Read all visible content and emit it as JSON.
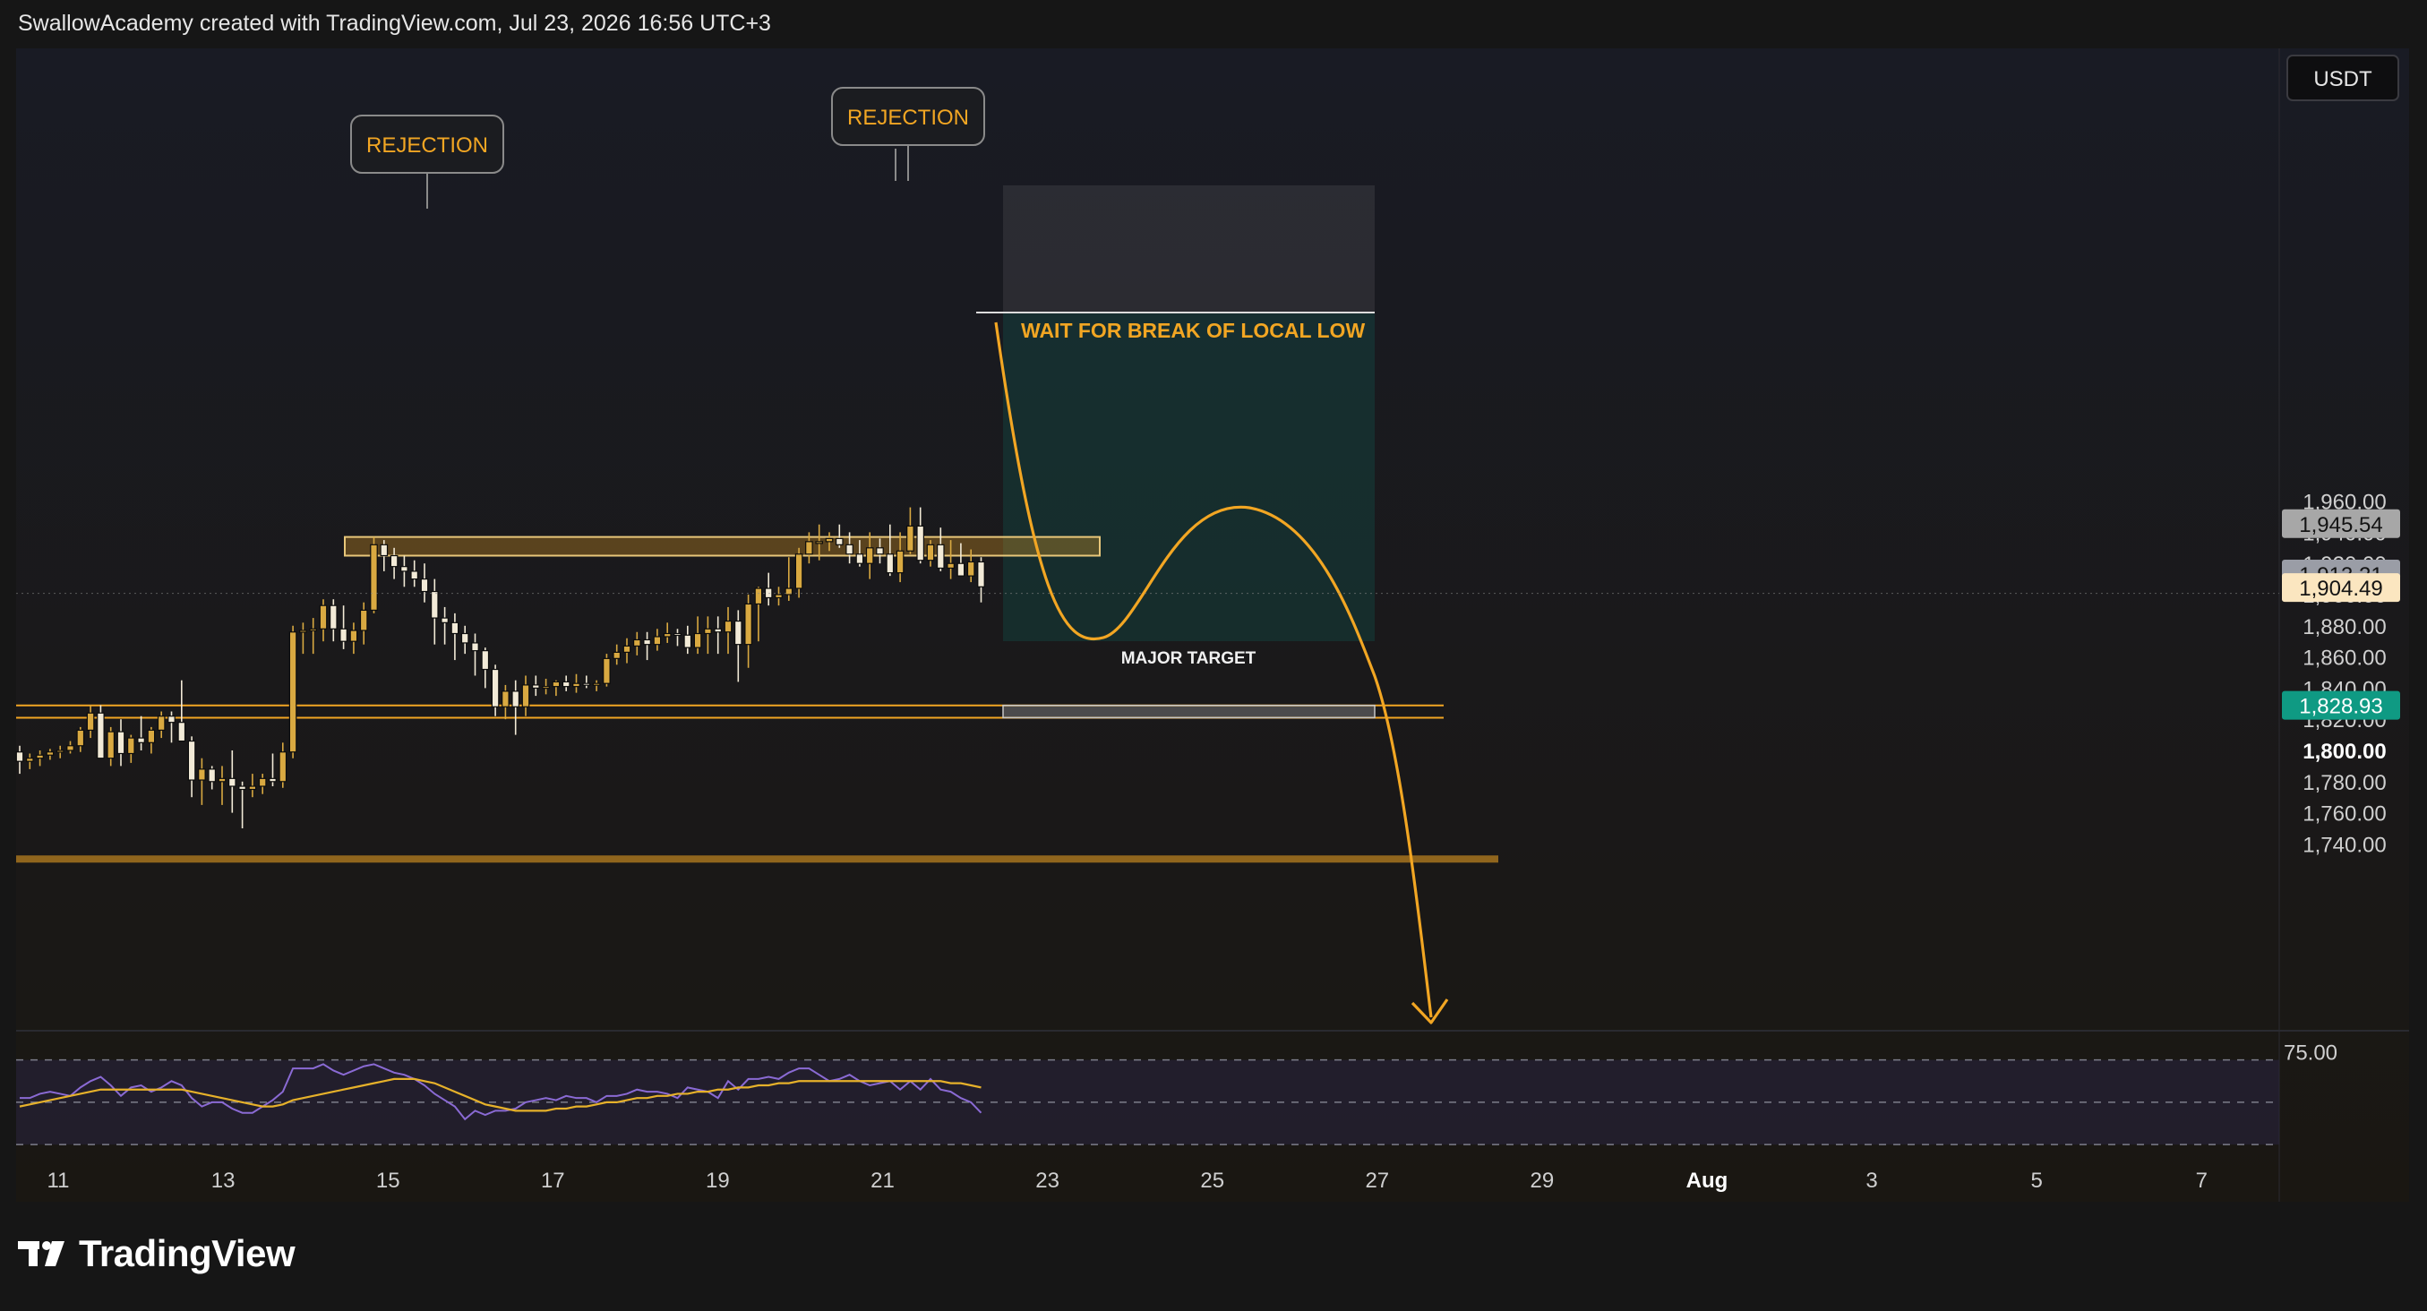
{
  "header": "SwallowAcademy created with TradingView.com, Jul 23, 2026 16:56 UTC+3",
  "brand": "TradingView",
  "currency": "USDT",
  "colors": {
    "accent": "#f2a623",
    "up_candle": "#d9a941",
    "down_candle": "#f2ead7",
    "target_green": "#0f9a83",
    "rsi": "#8a6ad4",
    "rsi_ma": "#e6b12a"
  },
  "chart_data": {
    "type": "candlestick",
    "y_axis": {
      "min": 1726,
      "max": 1974,
      "ticks": [
        "1,740.00",
        "1,760.00",
        "1,780.00",
        "1,800.00",
        "1,820.00",
        "1,840.00",
        "1,860.00",
        "1,880.00",
        "1,900.00",
        "1,920.00",
        "1,940.00",
        "1,960.00"
      ],
      "tick_values": [
        1740,
        1760,
        1780,
        1800,
        1820,
        1840,
        1860,
        1880,
        1900,
        1920,
        1940,
        1960
      ],
      "bold_tick": "1,800.00"
    },
    "x_axis": {
      "ticks": [
        "11",
        "13",
        "15",
        "17",
        "19",
        "21",
        "23",
        "25",
        "27",
        "29",
        "Aug",
        "3",
        "5",
        "7"
      ]
    },
    "price_labels": [
      {
        "text": "1,945.54",
        "value": 1945.54,
        "style": "grey"
      },
      {
        "text": "1,913.21",
        "value": 1913.21,
        "style": "slate"
      },
      {
        "text": "1,904.49",
        "value": 1904.49,
        "style": "cream"
      },
      {
        "text": "1,828.93",
        "value": 1828.93,
        "style": "green"
      }
    ],
    "resistance_zone": {
      "from": 1925,
      "to": 1937
    },
    "support_lines": [
      1828.9,
      1821
    ],
    "bottom_band": 1728,
    "annotations": {
      "rejection_1": "REJECTION",
      "rejection_2": "REJECTION",
      "wait_text": "WAIT FOR BREAK OF LOCAL LOW",
      "target_text": "MAJOR TARGET"
    },
    "candles": [
      [
        1799,
        1803,
        1785,
        1793
      ],
      [
        1793,
        1798,
        1788,
        1795
      ],
      [
        1795,
        1800,
        1790,
        1797
      ],
      [
        1797,
        1801,
        1794,
        1799
      ],
      [
        1799,
        1803,
        1795,
        1800
      ],
      [
        1800,
        1806,
        1798,
        1803
      ],
      [
        1803,
        1815,
        1799,
        1813
      ],
      [
        1813,
        1829,
        1808,
        1824
      ],
      [
        1824,
        1829,
        1795,
        1795
      ],
      [
        1795,
        1815,
        1790,
        1812
      ],
      [
        1812,
        1820,
        1790,
        1798
      ],
      [
        1798,
        1810,
        1792,
        1808
      ],
      [
        1808,
        1822,
        1800,
        1805
      ],
      [
        1805,
        1815,
        1798,
        1813
      ],
      [
        1813,
        1825,
        1808,
        1822
      ],
      [
        1822,
        1825,
        1805,
        1818
      ],
      [
        1818,
        1845,
        1808,
        1806
      ],
      [
        1806,
        1809,
        1770,
        1781
      ],
      [
        1781,
        1795,
        1765,
        1788
      ],
      [
        1788,
        1790,
        1775,
        1780
      ],
      [
        1780,
        1790,
        1765,
        1782
      ],
      [
        1782,
        1800,
        1760,
        1777
      ],
      [
        1777,
        1780,
        1750,
        1775
      ],
      [
        1775,
        1785,
        1770,
        1777
      ],
      [
        1777,
        1785,
        1772,
        1782
      ],
      [
        1782,
        1798,
        1777,
        1780
      ],
      [
        1780,
        1805,
        1776,
        1799
      ],
      [
        1799,
        1880,
        1795,
        1876
      ],
      [
        1876,
        1882,
        1862,
        1877
      ],
      [
        1877,
        1885,
        1862,
        1878
      ],
      [
        1878,
        1897,
        1870,
        1893
      ],
      [
        1893,
        1897,
        1870,
        1878
      ],
      [
        1878,
        1893,
        1865,
        1870
      ],
      [
        1870,
        1882,
        1862,
        1877
      ],
      [
        1877,
        1895,
        1868,
        1890
      ],
      [
        1890,
        1937,
        1888,
        1932
      ],
      [
        1932,
        1935,
        1915,
        1925
      ],
      [
        1925,
        1930,
        1910,
        1918
      ],
      [
        1918,
        1925,
        1905,
        1915
      ],
      [
        1915,
        1922,
        1905,
        1910
      ],
      [
        1910,
        1920,
        1895,
        1902
      ],
      [
        1902,
        1910,
        1868,
        1885
      ],
      [
        1885,
        1892,
        1868,
        1882
      ],
      [
        1882,
        1888,
        1858,
        1875
      ],
      [
        1875,
        1880,
        1862,
        1869
      ],
      [
        1869,
        1875,
        1848,
        1864
      ],
      [
        1864,
        1866,
        1840,
        1852
      ],
      [
        1852,
        1855,
        1822,
        1828
      ],
      [
        1828,
        1842,
        1820,
        1838
      ],
      [
        1838,
        1845,
        1810,
        1828
      ],
      [
        1828,
        1848,
        1822,
        1842
      ],
      [
        1842,
        1848,
        1835,
        1840
      ],
      [
        1840,
        1846,
        1836,
        1841
      ],
      [
        1841,
        1845,
        1835,
        1844
      ],
      [
        1844,
        1848,
        1838,
        1841
      ],
      [
        1841,
        1849,
        1837,
        1843
      ],
      [
        1843,
        1848,
        1840,
        1842
      ],
      [
        1842,
        1845,
        1838,
        1843
      ],
      [
        1843,
        1862,
        1841,
        1859
      ],
      [
        1859,
        1868,
        1855,
        1863
      ],
      [
        1863,
        1872,
        1856,
        1867
      ],
      [
        1867,
        1876,
        1861,
        1871
      ],
      [
        1871,
        1876,
        1858,
        1868
      ],
      [
        1868,
        1878,
        1864,
        1873
      ],
      [
        1873,
        1882,
        1869,
        1875
      ],
      [
        1875,
        1878,
        1867,
        1874
      ],
      [
        1874,
        1880,
        1862,
        1866
      ],
      [
        1866,
        1886,
        1862,
        1875
      ],
      [
        1875,
        1886,
        1862,
        1878
      ],
      [
        1878,
        1886,
        1862,
        1876
      ],
      [
        1876,
        1892,
        1862,
        1883
      ],
      [
        1883,
        1890,
        1844,
        1868
      ],
      [
        1868,
        1900,
        1853,
        1894
      ],
      [
        1894,
        1905,
        1870,
        1904
      ],
      [
        1904,
        1914,
        1893,
        1898
      ],
      [
        1898,
        1905,
        1893,
        1900
      ],
      [
        1900,
        1924,
        1896,
        1904
      ],
      [
        1904,
        1930,
        1898,
        1926
      ],
      [
        1926,
        1940,
        1920,
        1934
      ],
      [
        1934,
        1945,
        1922,
        1934
      ],
      [
        1934,
        1940,
        1928,
        1936
      ],
      [
        1936,
        1945,
        1930,
        1932
      ],
      [
        1932,
        1940,
        1920,
        1926
      ],
      [
        1926,
        1935,
        1918,
        1920
      ],
      [
        1920,
        1940,
        1910,
        1930
      ],
      [
        1930,
        1936,
        1920,
        1926
      ],
      [
        1926,
        1945,
        1912,
        1914
      ],
      [
        1914,
        1940,
        1908,
        1928
      ],
      [
        1928,
        1956,
        1926,
        1944
      ],
      [
        1944,
        1956,
        1920,
        1922
      ],
      [
        1922,
        1935,
        1918,
        1932
      ],
      [
        1932,
        1943,
        1915,
        1917
      ],
      [
        1917,
        1935,
        1910,
        1920
      ],
      [
        1920,
        1933,
        1913,
        1912
      ],
      [
        1912,
        1929,
        1908,
        1921
      ],
      [
        1921,
        1924,
        1895,
        1905
      ]
    ],
    "rsi": {
      "upper_label": "75.00",
      "levels": [
        70,
        50,
        30
      ],
      "ylim": [
        25,
        80
      ],
      "values": [
        52,
        52,
        54,
        55,
        54,
        53,
        57,
        60,
        62,
        58,
        53,
        57,
        58,
        55,
        57,
        60,
        58,
        52,
        48,
        50,
        50,
        47,
        45,
        45,
        48,
        51,
        55,
        66,
        66,
        66,
        68,
        65,
        63,
        65,
        67,
        68,
        66,
        64,
        63,
        61,
        58,
        54,
        51,
        48,
        42,
        46,
        44,
        46,
        46,
        47,
        50,
        51,
        52,
        51,
        53,
        52,
        52,
        50,
        53,
        53,
        54,
        56,
        55,
        55,
        54,
        52,
        57,
        56,
        55,
        52,
        60,
        56,
        61,
        61,
        62,
        61,
        64,
        66,
        66,
        63,
        60,
        61,
        63,
        60,
        58,
        59,
        60,
        56,
        60,
        56,
        61,
        56,
        55,
        52,
        50,
        45
      ],
      "ma": [
        48,
        49,
        50,
        51,
        52,
        53,
        54,
        55,
        56,
        56,
        56,
        56,
        56,
        56,
        56,
        56,
        56,
        55,
        54,
        53,
        52,
        51,
        50,
        49,
        48,
        48,
        49,
        51,
        52,
        53,
        54,
        55,
        56,
        57,
        58,
        59,
        60,
        61,
        61,
        61,
        60,
        59,
        57,
        55,
        53,
        51,
        49,
        48,
        47,
        46,
        46,
        46,
        46,
        47,
        47,
        48,
        48,
        49,
        50,
        50,
        51,
        52,
        52,
        53,
        53,
        54,
        54,
        55,
        55,
        56,
        56,
        57,
        57,
        58,
        58,
        59,
        59,
        60,
        60,
        60,
        60,
        60,
        60,
        60,
        60,
        60,
        60,
        60,
        60,
        60,
        60,
        60,
        59,
        59,
        58,
        57
      ]
    }
  }
}
